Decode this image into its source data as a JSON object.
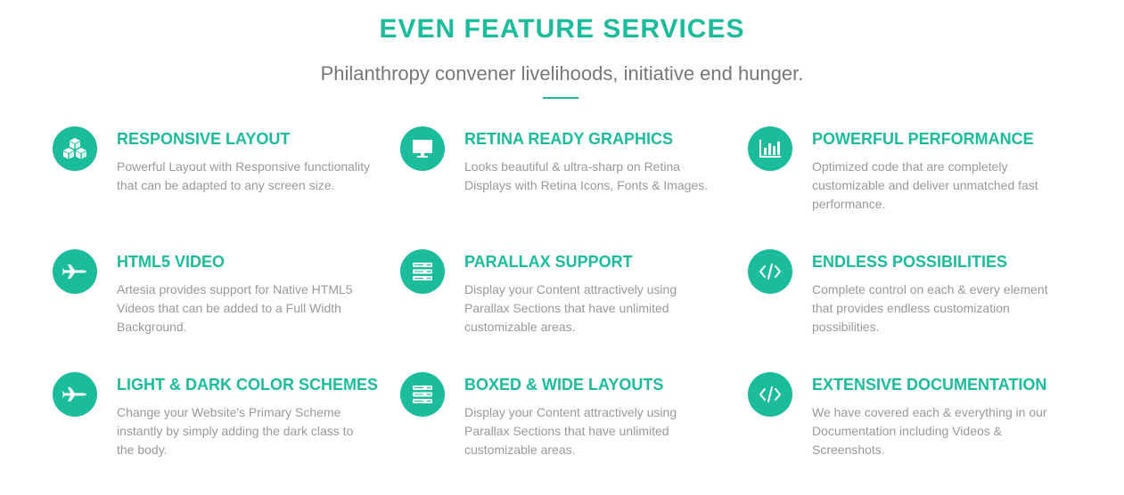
{
  "section": {
    "title": "EVEN FEATURE SERVICES",
    "subtitle": "Philanthropy convener livelihoods, initiative end hunger.",
    "accent_color": "#1abc9c"
  },
  "features": [
    {
      "icon": "cubes-icon",
      "title": "RESPONSIVE LAYOUT",
      "description": "Powerful Layout with Responsive functionality that can be adapted to any screen size."
    },
    {
      "icon": "monitor-icon",
      "title": "RETINA READY GRAPHICS",
      "description": "Looks beautiful & ultra-sharp on Retina Displays with Retina Icons, Fonts & Images."
    },
    {
      "icon": "bar-chart-icon",
      "title": "POWERFUL PERFORMANCE",
      "description": "Optimized code that are completely customizable and deliver unmatched fast performance."
    },
    {
      "icon": "plane-icon",
      "title": "HTML5 VIDEO",
      "description": "Artesia provides support for Native HTML5 Videos that can be added to a Full Width Background."
    },
    {
      "icon": "server-icon",
      "title": "PARALLAX SUPPORT",
      "description": "Display your Content attractively using Parallax Sections that have unlimited customizable areas."
    },
    {
      "icon": "code-icon",
      "title": "ENDLESS POSSIBILITIES",
      "description": "Complete control on each & every element that provides endless customization possibilities."
    },
    {
      "icon": "plane-icon",
      "title": "LIGHT & DARK COLOR SCHEMES",
      "description": "Change your Website's Primary Scheme instantly by simply adding the dark class to the body."
    },
    {
      "icon": "server-icon",
      "title": "BOXED & WIDE LAYOUTS",
      "description": "Display your Content attractively using Parallax Sections that have unlimited customizable areas."
    },
    {
      "icon": "code-icon",
      "title": "EXTENSIVE DOCUMENTATION",
      "description": "We have covered each & everything in our Documentation including Videos & Screenshots."
    }
  ]
}
